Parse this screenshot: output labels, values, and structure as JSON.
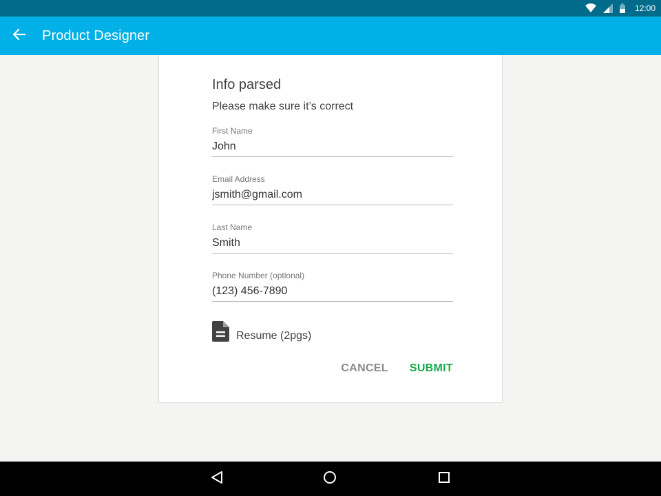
{
  "status_bar": {
    "time": "12:00",
    "icons": [
      "wifi-icon",
      "cell-signal-icon",
      "battery-icon"
    ]
  },
  "app_bar": {
    "title": "Product Designer",
    "back_icon": "arrow-back-icon"
  },
  "card": {
    "title": "Info parsed",
    "subtitle": "Please make sure it’s correct",
    "fields": [
      {
        "label": "First Name",
        "value": "John"
      },
      {
        "label": "Email Address",
        "value": "jsmith@gmail.com"
      },
      {
        "label": "Last Name",
        "value": "Smith"
      },
      {
        "label": "Phone Number (optional)",
        "value": "(123) 456-7890"
      }
    ],
    "attachment": {
      "icon": "document-icon",
      "label": "Resume (2pgs)"
    },
    "actions": {
      "cancel_label": "CANCEL",
      "submit_label": "SUBMIT"
    }
  },
  "nav_bar": {
    "icons": [
      "nav-back-icon",
      "nav-home-icon",
      "nav-recents-icon"
    ]
  },
  "colors": {
    "status_bar": "#006b8a",
    "app_bar": "#00b0e6",
    "background": "#f4f4f2",
    "submit": "#18a84a",
    "cancel": "#8a8a8a"
  }
}
